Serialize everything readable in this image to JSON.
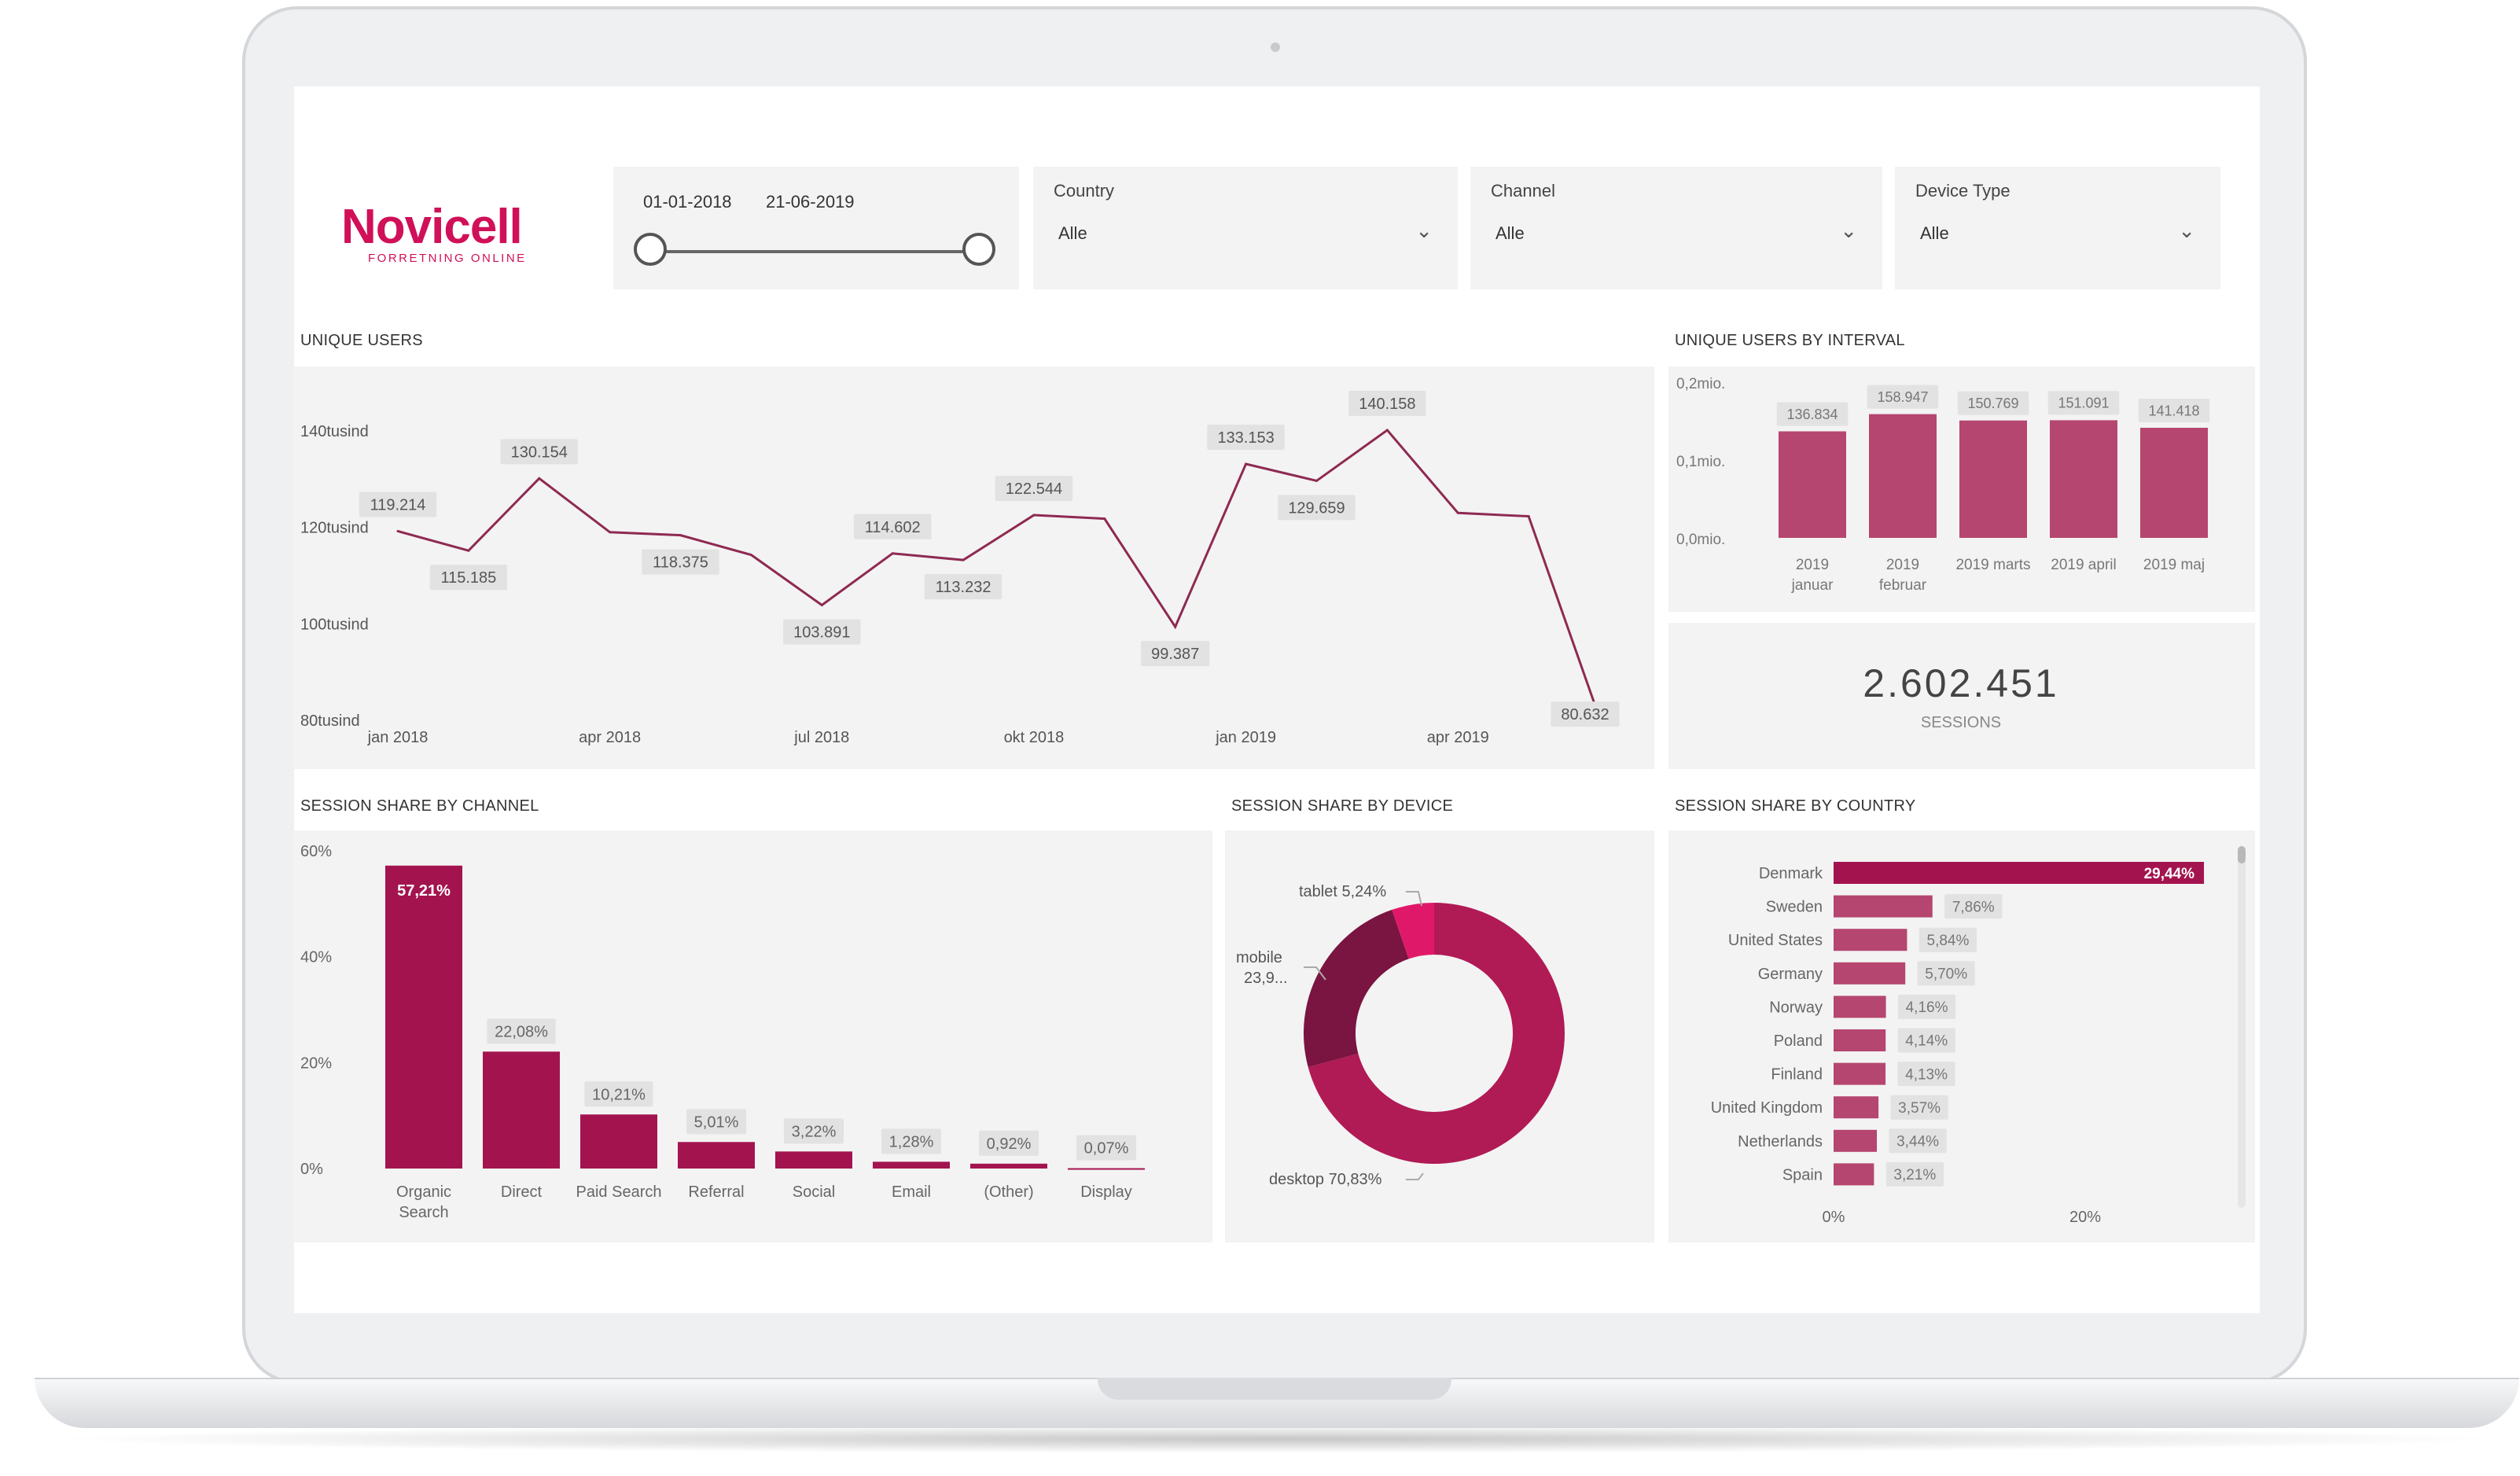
{
  "brand": {
    "name": "Novicell",
    "tagline": "FORRETNING ONLINE"
  },
  "colors": {
    "accent": "#a3144f",
    "bar": "#b5466f",
    "label_bg": "#e2e2e2"
  },
  "filters": {
    "date": {
      "start": "01-01-2018",
      "end": "21-06-2019"
    },
    "country": {
      "label": "Country",
      "value": "Alle"
    },
    "channel": {
      "label": "Channel",
      "value": "Alle"
    },
    "device_type": {
      "label": "Device Type",
      "value": "Alle"
    }
  },
  "sections": {
    "unique_users": "UNIQUE USERS",
    "unique_users_interval": "UNIQUE USERS BY INTERVAL",
    "session_channel": "SESSION SHARE BY CHANNEL",
    "session_device": "SESSION SHARE BY DEVICE",
    "session_country": "SESSION SHARE BY COUNTRY"
  },
  "kpi": {
    "value": "2.602.451",
    "label": "SESSIONS"
  },
  "chart_data": [
    {
      "id": "unique_users",
      "type": "line",
      "ylim": [
        80000,
        140000
      ],
      "yticks": [
        "140tusind",
        "120tusind",
        "100tusind",
        "80tusind"
      ],
      "xticks": [
        "jan 2018",
        "apr 2018",
        "jul 2018",
        "okt 2018",
        "jan 2019",
        "apr 2019"
      ],
      "x": [
        "2018-01",
        "2018-02",
        "2018-03",
        "2018-04",
        "2018-05",
        "2018-06",
        "2018-07",
        "2018-08",
        "2018-09",
        "2018-10",
        "2018-11",
        "2018-12",
        "2019-01",
        "2019-02",
        "2019-03",
        "2019-04",
        "2019-05",
        "2019-06"
      ],
      "values": [
        119214,
        115185,
        130154,
        119000,
        118375,
        114300,
        103891,
        114602,
        113232,
        122544,
        121800,
        99387,
        133153,
        129659,
        140158,
        123000,
        122300,
        80632
      ],
      "labels": [
        "119.214",
        "115.185",
        "130.154",
        "",
        "118.375",
        "",
        "103.891",
        "114.602",
        "113.232",
        "122.544",
        "",
        "99.387",
        "133.153",
        "129.659",
        "140.158",
        "",
        "",
        "80.632"
      ]
    },
    {
      "id": "unique_users_interval",
      "type": "bar",
      "categories": [
        "2019 januar",
        "2019 februar",
        "2019 marts",
        "2019 april",
        "2019 maj"
      ],
      "category_lines": [
        [
          "2019",
          "januar"
        ],
        [
          "2019",
          "februar"
        ],
        [
          "2019 marts"
        ],
        [
          "2019 april"
        ],
        [
          "2019 maj"
        ]
      ],
      "values": [
        136834,
        158947,
        150769,
        151091,
        141418
      ],
      "labels": [
        "136.834",
        "158.947",
        "150.769",
        "151.091",
        "141.418"
      ],
      "yticks": [
        "0,2mio.",
        "0,1mio.",
        "0,0mio."
      ],
      "ylim": [
        0,
        200000
      ]
    },
    {
      "id": "session_channel",
      "type": "bar",
      "categories": [
        "Organic Search",
        "Direct",
        "Paid Search",
        "Referral",
        "Social",
        "Email",
        "(Other)",
        "Display"
      ],
      "category_lines": [
        [
          "Organic",
          "Search"
        ],
        [
          "Direct"
        ],
        [
          "Paid Search"
        ],
        [
          "Referral"
        ],
        [
          "Social"
        ],
        [
          "Email"
        ],
        [
          "(Other)"
        ],
        [
          "Display"
        ]
      ],
      "values": [
        57.21,
        22.08,
        10.21,
        5.01,
        3.22,
        1.28,
        0.92,
        0.07
      ],
      "labels": [
        "57,21%",
        "22,08%",
        "10,21%",
        "5,01%",
        "3,22%",
        "1,28%",
        "0,92%",
        "0,07%"
      ],
      "yticks": [
        "60%",
        "40%",
        "20%",
        "0%"
      ],
      "ylim": [
        0,
        60
      ]
    },
    {
      "id": "session_device",
      "type": "pie",
      "categories": [
        "desktop",
        "mobile",
        "tablet"
      ],
      "values": [
        70.83,
        23.93,
        5.24
      ],
      "labels": [
        "desktop 70,83%",
        "mobile 23,9...",
        "tablet 5,24%"
      ],
      "colors": [
        "#b01a55",
        "#7a1440",
        "#e0186a"
      ]
    },
    {
      "id": "session_country",
      "type": "bar",
      "orientation": "horizontal",
      "categories": [
        "Denmark",
        "Sweden",
        "United States",
        "Germany",
        "Norway",
        "Poland",
        "Finland",
        "United Kingdom",
        "Netherlands",
        "Spain"
      ],
      "values": [
        29.44,
        7.86,
        5.84,
        5.7,
        4.16,
        4.14,
        4.13,
        3.57,
        3.44,
        3.21
      ],
      "labels": [
        "29,44%",
        "7,86%",
        "5,84%",
        "5,70%",
        "4,16%",
        "4,14%",
        "4,13%",
        "3,57%",
        "3,44%",
        "3,21%"
      ],
      "xticks": [
        "0%",
        "20%"
      ],
      "xlim": [
        0,
        30
      ]
    }
  ]
}
